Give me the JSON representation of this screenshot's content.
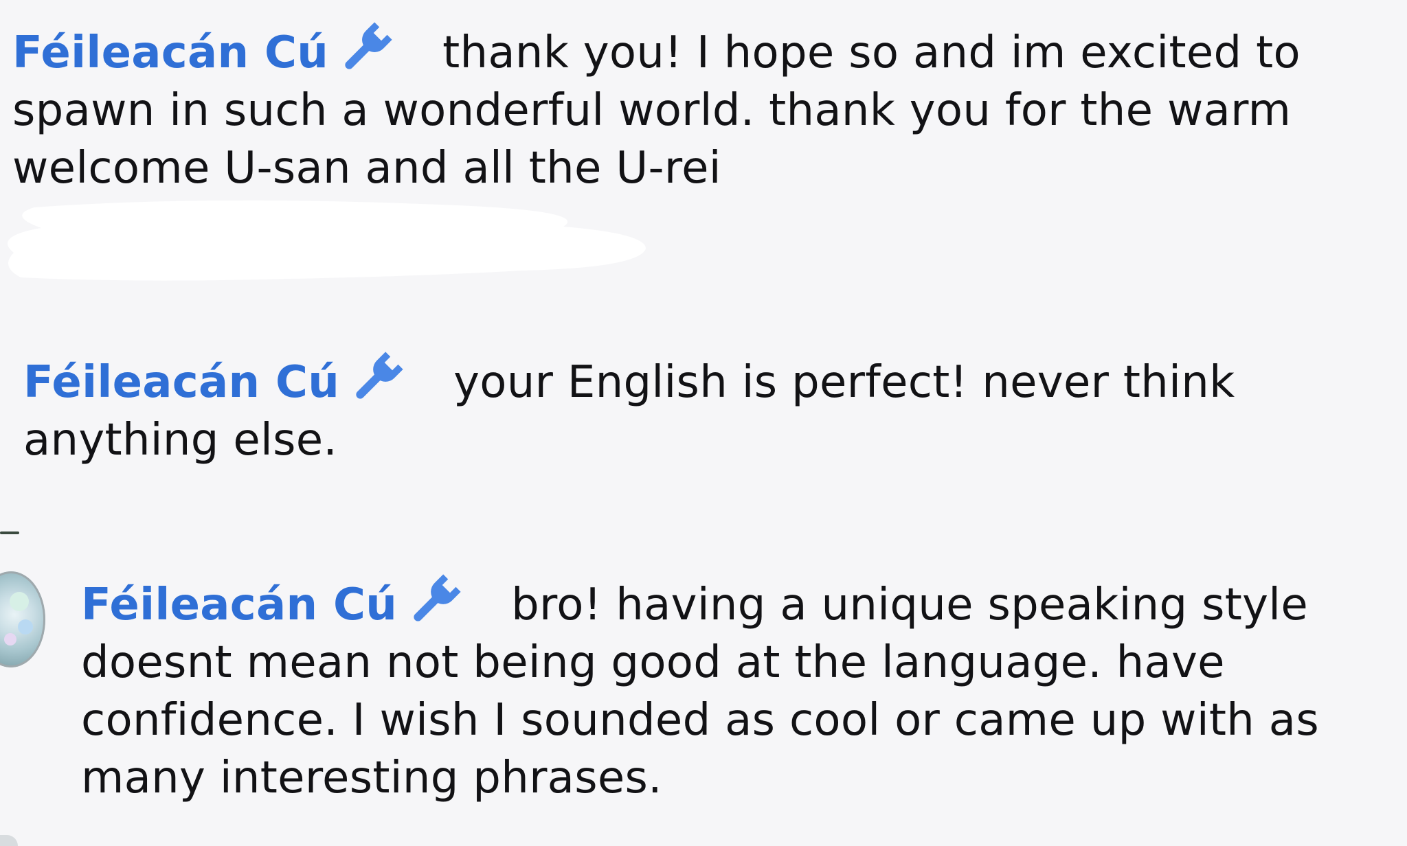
{
  "messages": [
    {
      "author": "Féileacán Cú",
      "badge_icon": "wrench-icon",
      "text": "thank you! I hope so and im excited to spawn in such a wonderful world. thank you for the warm welcome U-san and all the U-rei"
    },
    {
      "author": "Féileacán Cú",
      "badge_icon": "wrench-icon",
      "text": "your English is perfect! never think anything else."
    },
    {
      "author": "Féileacán Cú",
      "badge_icon": "wrench-icon",
      "text": "bro! having a unique speaking style doesnt mean not being good at the language. have confidence. I wish I sounded as cool or came up with as many interesting phrases."
    }
  ],
  "colors": {
    "background": "#f6f6f8",
    "author_name": "#2f6fd6",
    "badge_icon": "#4a87e6",
    "message_text": "#121215"
  }
}
